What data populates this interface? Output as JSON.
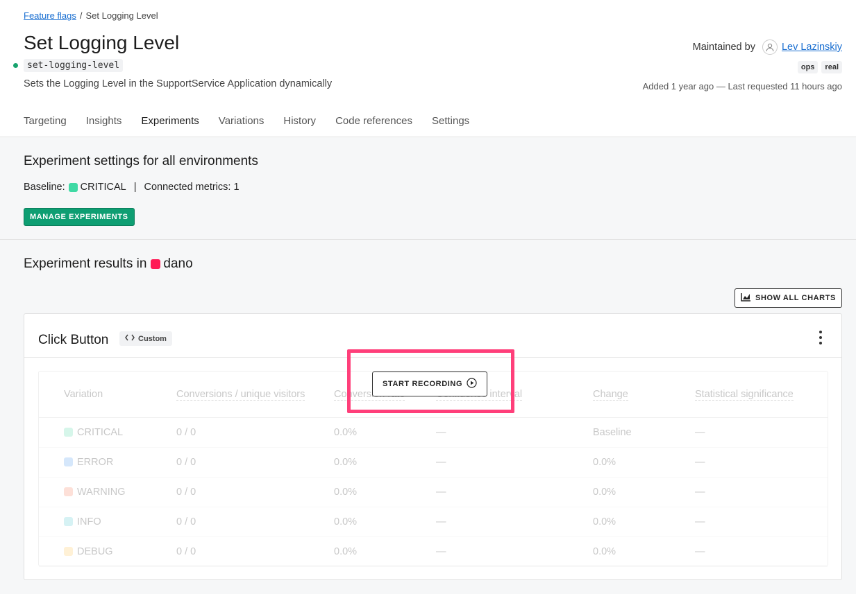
{
  "breadcrumb": {
    "parent": "Feature flags",
    "separator": "/",
    "current": "Set Logging Level"
  },
  "flag": {
    "title": "Set Logging Level",
    "key": "set-logging-level",
    "description": "Sets the Logging Level in the SupportService Application dynamically",
    "status_color": "#18a36e"
  },
  "maintainer": {
    "label": "Maintained by",
    "name": "Lev Lazinskiy",
    "avatar_icon": "user-icon"
  },
  "tags": [
    "ops",
    "real"
  ],
  "added_text": "Added 1 year ago — Last requested 11 hours ago",
  "tabs": [
    {
      "label": "Targeting",
      "active": false
    },
    {
      "label": "Insights",
      "active": false
    },
    {
      "label": "Experiments",
      "active": true
    },
    {
      "label": "Variations",
      "active": false
    },
    {
      "label": "History",
      "active": false
    },
    {
      "label": "Code references",
      "active": false
    },
    {
      "label": "Settings",
      "active": false
    }
  ],
  "experiment_settings": {
    "title": "Experiment settings for all environments",
    "baseline_label": "Baseline:",
    "baseline_value": "CRITICAL",
    "baseline_color": "#3fd9a4",
    "separator": "|",
    "metrics_text": "Connected metrics: 1",
    "manage_button": "MANAGE EXPERIMENTS"
  },
  "results": {
    "title_prefix": "Experiment results in",
    "environment": "dano",
    "environment_color": "#ff1a55",
    "show_charts_button": "SHOW ALL CHARTS",
    "show_charts_icon": "chart-icon"
  },
  "metric_card": {
    "title": "Click Button",
    "badge_icon": "code-icon",
    "badge_label": "Custom",
    "menu_icon": "kebab-menu-icon",
    "start_recording_button": "START RECORDING",
    "start_recording_icon": "play-circle-icon",
    "columns": [
      "Variation",
      "Conversions / unique visitors",
      "Conversion rate",
      "Confidence interval",
      "Change",
      "Statistical significance"
    ],
    "rows": [
      {
        "variation": "CRITICAL",
        "color": "#d6f6ea",
        "conversions": "0 / 0",
        "rate": "0.0%",
        "interval": "—",
        "change": "Baseline",
        "significance": "—"
      },
      {
        "variation": "ERROR",
        "color": "#d5e7fb",
        "conversions": "0 / 0",
        "rate": "0.0%",
        "interval": "—",
        "change": "0.0%",
        "significance": "—"
      },
      {
        "variation": "WARNING",
        "color": "#fde0d8",
        "conversions": "0 / 0",
        "rate": "0.0%",
        "interval": "—",
        "change": "0.0%",
        "significance": "—"
      },
      {
        "variation": "INFO",
        "color": "#d6f2f4",
        "conversions": "0 / 0",
        "rate": "0.0%",
        "interval": "—",
        "change": "0.0%",
        "significance": "—"
      },
      {
        "variation": "DEBUG",
        "color": "#fff1d6",
        "conversions": "0 / 0",
        "rate": "0.0%",
        "interval": "—",
        "change": "0.0%",
        "significance": "—"
      }
    ]
  },
  "highlight_color": "#ff3f7a"
}
